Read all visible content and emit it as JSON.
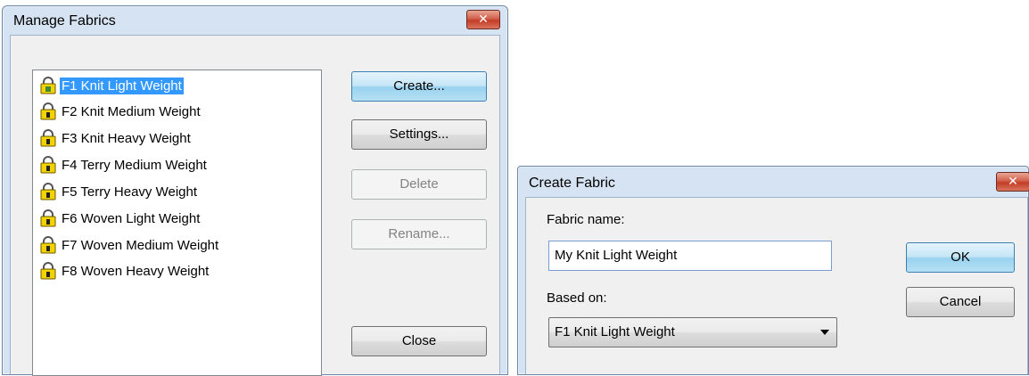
{
  "manage_dialog": {
    "title": "Manage Fabrics",
    "close_glyph": "✕",
    "fabrics": [
      {
        "label": "F1 Knit Light Weight",
        "selected": true,
        "icon": "lock-icon"
      },
      {
        "label": "F2 Knit Medium Weight",
        "selected": false,
        "icon": "lock-icon"
      },
      {
        "label": "F3 Knit Heavy Weight",
        "selected": false,
        "icon": "lock-icon"
      },
      {
        "label": "F4 Terry Medium Weight",
        "selected": false,
        "icon": "lock-icon"
      },
      {
        "label": "F5 Terry Heavy Weight",
        "selected": false,
        "icon": "lock-icon"
      },
      {
        "label": "F6 Woven Light Weight",
        "selected": false,
        "icon": "lock-icon"
      },
      {
        "label": "F7 Woven Medium Weight",
        "selected": false,
        "icon": "lock-icon"
      },
      {
        "label": "F8 Woven Heavy Weight",
        "selected": false,
        "icon": "lock-icon"
      }
    ],
    "buttons": {
      "create": "Create...",
      "settings": "Settings...",
      "delete": "Delete",
      "rename": "Rename...",
      "close": "Close"
    }
  },
  "create_dialog": {
    "title": "Create Fabric",
    "close_glyph": "✕",
    "fabric_name_label": "Fabric name:",
    "fabric_name_value": "My Knit Light Weight",
    "based_on_label": "Based on:",
    "based_on_value": "F1 Knit Light Weight",
    "ok": "OK",
    "cancel": "Cancel"
  },
  "colors": {
    "selection": "#3399ff",
    "dialog_frame": "#d6e3f2",
    "close_button": "#c43c26"
  }
}
